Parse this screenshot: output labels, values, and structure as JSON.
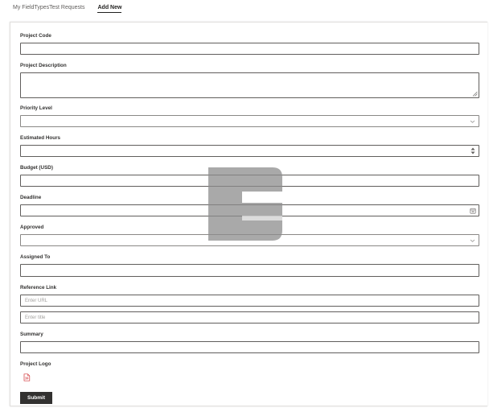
{
  "tabs": [
    {
      "label": "My FieldTypesTest Requests"
    },
    {
      "label": "Add New"
    }
  ],
  "form": {
    "project_code": {
      "label": "Project Code"
    },
    "project_description": {
      "label": "Project Description"
    },
    "priority_level": {
      "label": "Priority Level"
    },
    "estimated_hours": {
      "label": "Estimated Hours"
    },
    "budget": {
      "label": "Budget (USD)"
    },
    "deadline": {
      "label": "Deadline"
    },
    "approved": {
      "label": "Approved"
    },
    "assigned_to": {
      "label": "Assigned To"
    },
    "reference_link": {
      "label": "Reference Link",
      "url_placeholder": "Enter URL",
      "title_placeholder": "Enter title"
    },
    "summary": {
      "label": "Summary"
    },
    "project_logo": {
      "label": "Project Logo"
    },
    "submit_label": "Submit"
  },
  "colors": {
    "button_bg": "#323130",
    "border": "#605e5c",
    "broken_image_icon": "#d13438"
  },
  "icons": [
    "chevron-down-icon",
    "spinner-arrows-icon",
    "calendar-icon",
    "resize-handle-icon",
    "broken-image-icon",
    "watermark-logo"
  ]
}
